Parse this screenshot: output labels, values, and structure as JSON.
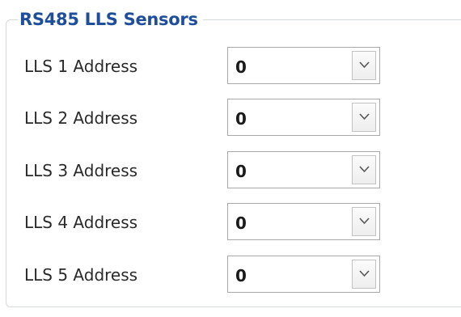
{
  "group": {
    "title": "RS485 LLS Sensors"
  },
  "rows": [
    {
      "label": "LLS 1 Address",
      "value": "0"
    },
    {
      "label": "LLS 2 Address",
      "value": "0"
    },
    {
      "label": "LLS 3 Address",
      "value": "0"
    },
    {
      "label": "LLS 4 Address",
      "value": "0"
    },
    {
      "label": "LLS 5 Address",
      "value": "0"
    }
  ],
  "icons": {
    "dropdown": "chevron-down-icon"
  },
  "colors": {
    "title": "#1f4e9b",
    "border": "#d5d9de"
  }
}
